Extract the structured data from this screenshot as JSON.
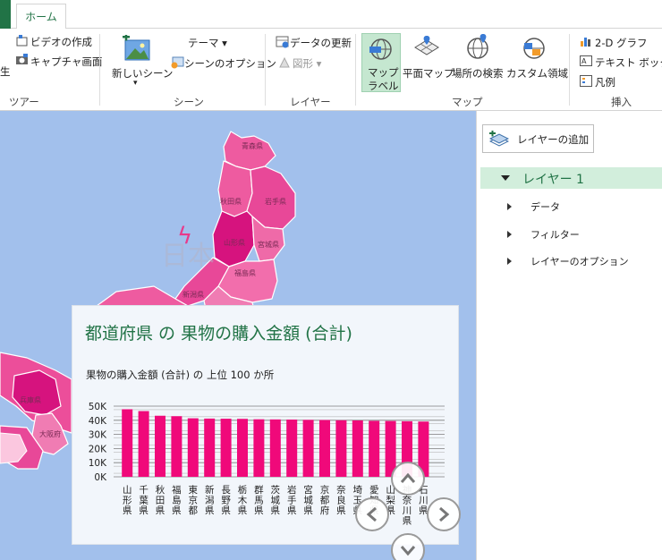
{
  "ribbon": {
    "home_tab": "ホーム",
    "tour": {
      "video_label": "ビデオの作成",
      "capture_label": "キャプチャ画面",
      "play_label_fragment": "生",
      "group_name": "ツアー"
    },
    "scene": {
      "new_scene_label": "新しいシーン",
      "theme_label": "テーマ ▾",
      "scene_options_label": "シーンのオプション",
      "group_name": "シーン"
    },
    "layer": {
      "refresh_data_label": "データの更新",
      "shapes_label": "図形 ▾",
      "group_name": "レイヤー"
    },
    "map": {
      "map_labels_line1": "マップ",
      "map_labels_line2": "ラベル",
      "flat_map_label": "平面マップ",
      "find_location_label": "場所の検索",
      "custom_regions_label": "カスタム領域",
      "group_name": "マップ"
    },
    "insert": {
      "chart_2d_label": "2-D グラフ",
      "text_box_label": "テキスト ボックス",
      "legend_label": "凡例",
      "group_name": "挿入"
    }
  },
  "map": {
    "labels": [
      "青森県",
      "秋田県",
      "岩手県",
      "山形県",
      "宮城県",
      "福島県",
      "新潟県",
      "日本",
      "兵庫県",
      "大阪府"
    ]
  },
  "chart_card": {
    "title": "都道府県 の 果物の購入金額 (合計)",
    "subtitle": "果物の購入金額 (合計) の 上位 100 か所"
  },
  "chart_data": {
    "type": "bar",
    "categories": [
      "山形県",
      "千葉県",
      "秋田県",
      "福島県",
      "東京都",
      "新潟県",
      "長野県",
      "栃木県",
      "群馬県",
      "茨城県",
      "岩手県",
      "宮城県",
      "京都府",
      "奈良県",
      "埼玉県",
      "愛知県",
      "山梨県",
      "神奈川県",
      "石川県"
    ],
    "values": [
      47800,
      46500,
      43200,
      42900,
      41400,
      41200,
      41100,
      41000,
      40700,
      40600,
      40500,
      40300,
      40200,
      40000,
      39900,
      39600,
      39500,
      39300,
      39100
    ],
    "yticks": [
      "0K",
      "10K",
      "20K",
      "30K",
      "40K",
      "50K"
    ],
    "ylim": [
      0,
      50000
    ],
    "bar_color": "#f0097a",
    "grid": true
  },
  "layer_pane": {
    "add_layer_label": "レイヤーの追加",
    "layer_name": "レイヤー 1",
    "items": [
      "データ",
      "フィルター",
      "レイヤーのオプション"
    ]
  },
  "colors": {
    "accent": "#217346",
    "map_water": "#a2c0ec",
    "map_land": "#ee5ba0"
  },
  "icons": [
    "video-icon",
    "capture-icon",
    "new-scene-icon",
    "scene-options-icon",
    "refresh-data-icon",
    "shapes-icon",
    "map-labels-globe-icon",
    "flat-map-icon",
    "find-location-icon",
    "custom-regions-icon",
    "chart-2d-icon",
    "text-box-icon",
    "legend-icon",
    "add-layer-icon",
    "nav-up-icon",
    "nav-left-icon",
    "nav-right-icon",
    "nav-down-icon"
  ]
}
